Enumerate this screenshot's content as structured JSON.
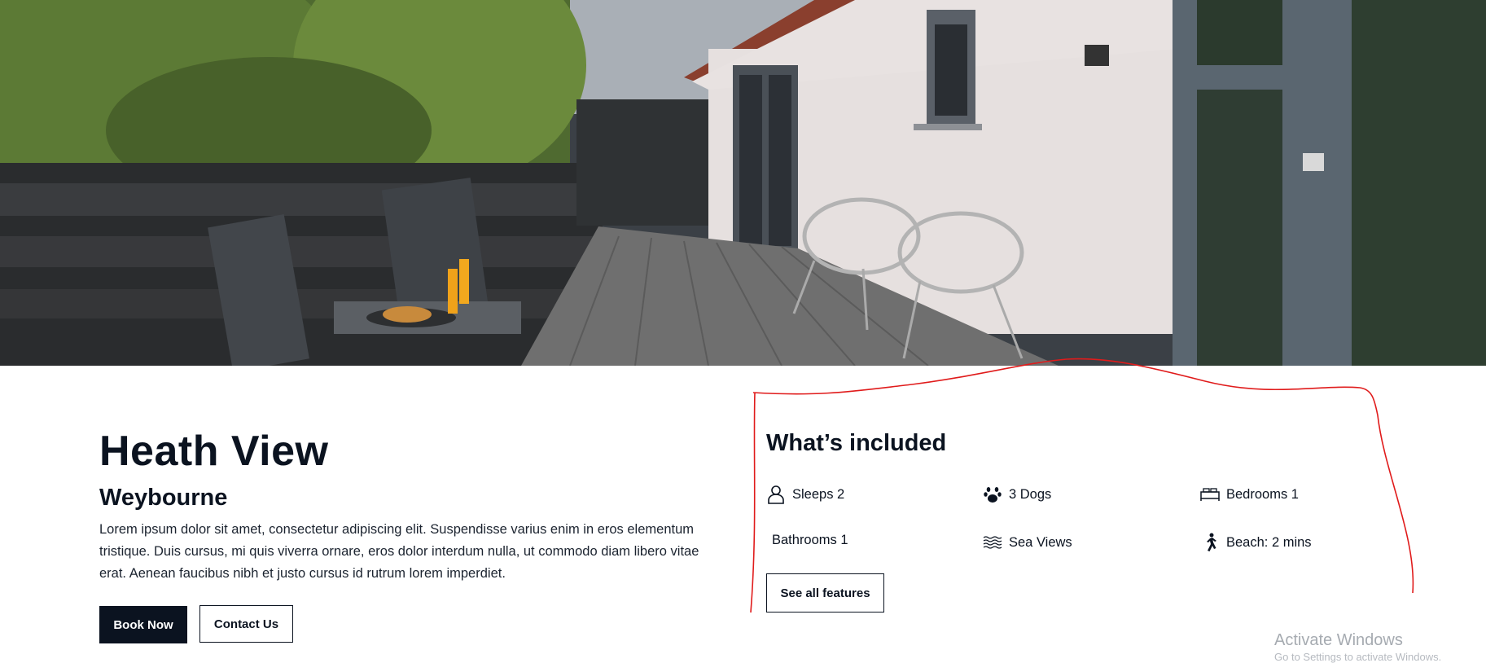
{
  "property": {
    "title": "Heath View",
    "location": "Weybourne",
    "description": "Lorem ipsum dolor sit amet, consectetur adipiscing elit. Suspendisse varius enim in eros elementum tristique. Duis cursus, mi quis viverra ornare, eros dolor interdum nulla, ut commodo diam libero vitae erat. Aenean faucibus nibh et justo cursus id rutrum lorem imperdiet.",
    "book_label": "Book Now",
    "contact_label": "Contact Us"
  },
  "features": {
    "heading": "What’s included",
    "items": [
      {
        "label": "Sleeps 2",
        "icon": "person-icon"
      },
      {
        "label": "3 Dogs",
        "icon": "paw-icon"
      },
      {
        "label": "Bedrooms 1",
        "icon": "bed-icon"
      },
      {
        "label": "Bathrooms 1",
        "icon": ""
      },
      {
        "label": "Sea Views",
        "icon": "waves-icon"
      },
      {
        "label": "Beach: 2 mins",
        "icon": "walking-icon"
      }
    ],
    "see_all_label": "See all features"
  },
  "hero": {
    "image": "patio-deck-photo"
  },
  "annotation": {
    "color": "#e01b1b"
  },
  "watermark": {
    "title": "Activate Windows",
    "subtitle": "Go to Settings to activate Windows."
  },
  "colors": {
    "brand_dark": "#0b1320",
    "background": "#ffffff"
  }
}
